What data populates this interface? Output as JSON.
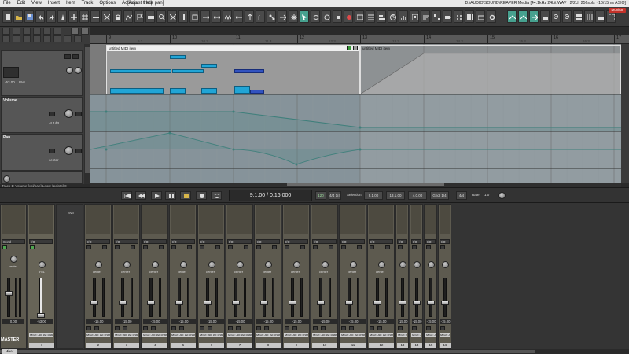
{
  "menu": {
    "items": [
      "File",
      "Edit",
      "View",
      "Insert",
      "Item",
      "Track",
      "Options",
      "Actions",
      "Help"
    ],
    "window_title": "[Adjust track pan]",
    "path_title": "D:\\AUDIO\\SOUND\\REAPER Media [44.1kHz 24bit WAV : 2/2ch 256spls ~10/15ms ASIO]"
  },
  "toolbar": {
    "monitor_label": "Monitor"
  },
  "ruler": {
    "bars": [
      "9",
      "10",
      "11",
      "12",
      "13",
      "14",
      "15",
      "16",
      "17"
    ],
    "subs": [
      "9.2",
      "9.3",
      "9.4",
      "10.2",
      "10.3",
      "10.4",
      "11.2",
      "11.3",
      "11.4",
      "12.2",
      "12.3",
      "12.4",
      "13.2",
      "13.3",
      "13.4",
      "14.2",
      "14.3",
      "14.4",
      "15.2",
      "15.3",
      "15.4",
      "16.2",
      "16.3",
      "16.4"
    ]
  },
  "tracks": {
    "t1_in": "I/O",
    "t1_vol": "-53.00",
    "t1_pan": "8%L",
    "volume_lane": "Volume",
    "volume_value": "-4.1dB",
    "pan_lane": "Pan",
    "pan_value": "center",
    "status": "Track 1: Volume [vol/pan] Loop: [points] 0"
  },
  "items": {
    "item1_title": "untitled MIDI item",
    "item2_title": "untitled MIDI item"
  },
  "transport": {
    "time": "9.1.00 / 0:16.000",
    "bpm_label": "120",
    "sig_label": "4/4 1/4",
    "selection_label": "Selection:",
    "sel_start": "9.1.00",
    "sel_end": "13.1.00",
    "sel_len": "4.0.00",
    "grid_label": "Grid: 1/4",
    "ts_label": "4/4",
    "rate_label": "Rate:",
    "rate_value": "1.0"
  },
  "mixer": {
    "master_label": "MASTER",
    "master_db": "0.00",
    "master_pan": "center",
    "send_label": "Send",
    "strip1_pan": "8%L",
    "strip1_db": "-53.00",
    "strip1_name": "MIDI: All: All channels",
    "strip1_num": "1",
    "io_label": "I/O",
    "rec_label": "rcvd",
    "strip_db": "-15.00",
    "strip_pan": "center",
    "strip_name": "MIDI: All: All chann",
    "strip_nums": [
      "2",
      "3",
      "4",
      "5",
      "6",
      "7",
      "8",
      "9",
      "10",
      "11",
      "12",
      "13",
      "14",
      "15",
      "16"
    ],
    "mixer_button": "Mixer"
  },
  "colors": {
    "accent": "#47a18f",
    "midi_note": "#21a5d6",
    "monitor_red": "#c4322a",
    "envelope": "#6fa8a0"
  }
}
